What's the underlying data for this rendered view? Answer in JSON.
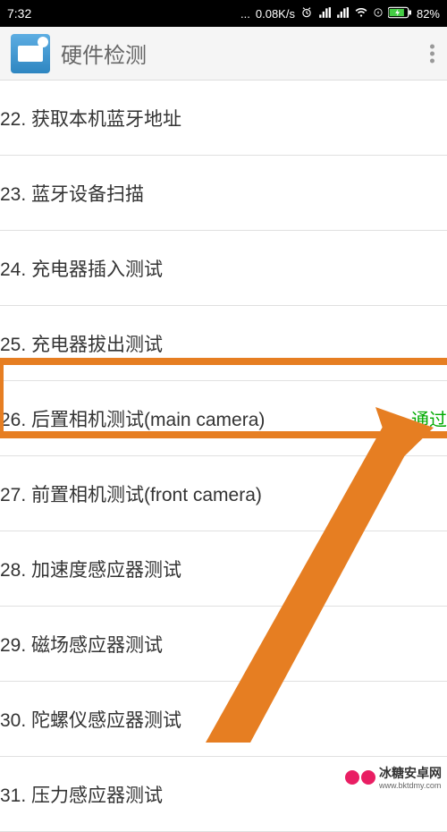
{
  "statusBar": {
    "time": "7:32",
    "dots": "...",
    "netSpeed": "0.08K/s",
    "battery": "82%"
  },
  "header": {
    "title": "硬件检测"
  },
  "list": [
    {
      "label": "22. 获取本机蓝牙地址",
      "status": ""
    },
    {
      "label": "23. 蓝牙设备扫描",
      "status": ""
    },
    {
      "label": "24. 充电器插入测试",
      "status": ""
    },
    {
      "label": "25. 充电器拔出测试",
      "status": ""
    },
    {
      "label": "26. 后置相机测试(main camera)",
      "status": "通过"
    },
    {
      "label": "27. 前置相机测试(front camera)",
      "status": ""
    },
    {
      "label": "28. 加速度感应器测试",
      "status": ""
    },
    {
      "label": "29. 磁场感应器测试",
      "status": ""
    },
    {
      "label": "30. 陀螺仪感应器测试",
      "status": ""
    },
    {
      "label": "31. 压力感应器测试",
      "status": ""
    }
  ],
  "watermark": {
    "name": "冰糖安卓网",
    "url": "www.bktdmy.com"
  }
}
